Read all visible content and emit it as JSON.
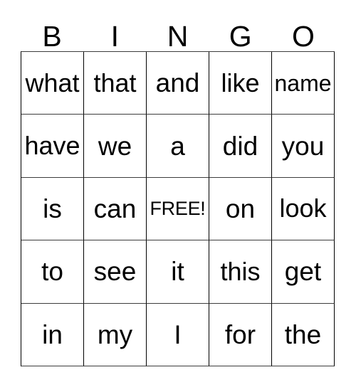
{
  "card": {
    "title": "BINGO",
    "header_letters": [
      "B",
      "I",
      "N",
      "G",
      "O"
    ],
    "free_space_label": "FREE!",
    "colors": {
      "background": "#ffffff",
      "text": "#000000",
      "grid_line": "#000000",
      "grid_line_soft": "#3c3c3c"
    },
    "grid": {
      "columns": 5,
      "rows": 5,
      "cells": [
        [
          {
            "text": "what"
          },
          {
            "text": "that"
          },
          {
            "text": "and"
          },
          {
            "text": "like"
          },
          {
            "text": "name"
          }
        ],
        [
          {
            "text": "have"
          },
          {
            "text": "we"
          },
          {
            "text": "a"
          },
          {
            "text": "did"
          },
          {
            "text": "you"
          }
        ],
        [
          {
            "text": "is"
          },
          {
            "text": "can"
          },
          {
            "text": "FREE!"
          },
          {
            "text": "on"
          },
          {
            "text": "look"
          }
        ],
        [
          {
            "text": "to"
          },
          {
            "text": "see"
          },
          {
            "text": "it"
          },
          {
            "text": "this"
          },
          {
            "text": "get"
          }
        ],
        [
          {
            "text": "in"
          },
          {
            "text": "my"
          },
          {
            "text": "I"
          },
          {
            "text": "for"
          },
          {
            "text": "the"
          }
        ]
      ]
    }
  }
}
